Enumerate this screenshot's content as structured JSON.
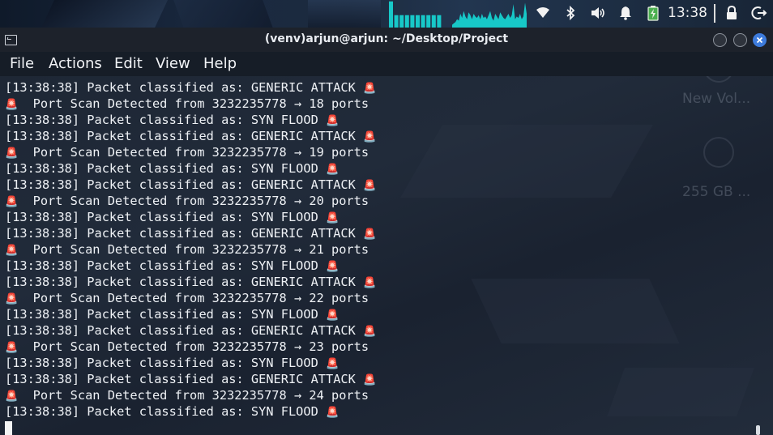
{
  "panel": {
    "clock": "13:38",
    "icons": [
      "wifi-icon",
      "bluetooth-icon",
      "volume-icon",
      "bell-icon",
      "battery-charging-icon",
      "lock-icon",
      "logout-icon"
    ],
    "cpu_bars": [
      0.95,
      0.45,
      0.45,
      0.45,
      0.45,
      0.45,
      0.45,
      0.45,
      0.45,
      0.45
    ],
    "net_levels": [
      0.1,
      0.15,
      0.2,
      0.3,
      0.25,
      0.5,
      0.35,
      0.6,
      0.4,
      0.3,
      0.55,
      0.45,
      0.3,
      0.5,
      0.4,
      0.35,
      0.45,
      0.3,
      0.5,
      0.35,
      0.4,
      0.3,
      0.45,
      0.6,
      0.35,
      0.25,
      0.5,
      0.4,
      0.3,
      0.55,
      0.45,
      0.35,
      0.3,
      0.4,
      0.5,
      0.35,
      0.45,
      0.85,
      0.3,
      0.4,
      0.35,
      0.5,
      0.3,
      0.4,
      0.9,
      0.5
    ],
    "accent": "#17c8c8"
  },
  "window": {
    "title": "(venv)arjun@arjun: ~/Desktop/Project",
    "menu": [
      "File",
      "Actions",
      "Edit",
      "View",
      "Help"
    ]
  },
  "desktop": {
    "labels": [
      "New Vol...",
      "255 GB ..."
    ]
  },
  "terminal": {
    "siren_glyph": "🚨",
    "lines": [
      {
        "text": "[13:38:38] Packet classified as: GENERIC ATTACK",
        "prefix": false,
        "suffix": true
      },
      {
        "text": "  Port Scan Detected from 3232235778 → 18 ports",
        "prefix": true,
        "suffix": false
      },
      {
        "text": "[13:38:38] Packet classified as: SYN FLOOD",
        "prefix": false,
        "suffix": true
      },
      {
        "text": "[13:38:38] Packet classified as: GENERIC ATTACK",
        "prefix": false,
        "suffix": true
      },
      {
        "text": "  Port Scan Detected from 3232235778 → 19 ports",
        "prefix": true,
        "suffix": false
      },
      {
        "text": "[13:38:38] Packet classified as: SYN FLOOD",
        "prefix": false,
        "suffix": true
      },
      {
        "text": "[13:38:38] Packet classified as: GENERIC ATTACK",
        "prefix": false,
        "suffix": true
      },
      {
        "text": "  Port Scan Detected from 3232235778 → 20 ports",
        "prefix": true,
        "suffix": false
      },
      {
        "text": "[13:38:38] Packet classified as: SYN FLOOD",
        "prefix": false,
        "suffix": true
      },
      {
        "text": "[13:38:38] Packet classified as: GENERIC ATTACK",
        "prefix": false,
        "suffix": true
      },
      {
        "text": "  Port Scan Detected from 3232235778 → 21 ports",
        "prefix": true,
        "suffix": false
      },
      {
        "text": "[13:38:38] Packet classified as: SYN FLOOD",
        "prefix": false,
        "suffix": true
      },
      {
        "text": "[13:38:38] Packet classified as: GENERIC ATTACK",
        "prefix": false,
        "suffix": true
      },
      {
        "text": "  Port Scan Detected from 3232235778 → 22 ports",
        "prefix": true,
        "suffix": false
      },
      {
        "text": "[13:38:38] Packet classified as: SYN FLOOD",
        "prefix": false,
        "suffix": true
      },
      {
        "text": "[13:38:38] Packet classified as: GENERIC ATTACK",
        "prefix": false,
        "suffix": true
      },
      {
        "text": "  Port Scan Detected from 3232235778 → 23 ports",
        "prefix": true,
        "suffix": false
      },
      {
        "text": "[13:38:38] Packet classified as: SYN FLOOD",
        "prefix": false,
        "suffix": true
      },
      {
        "text": "[13:38:38] Packet classified as: GENERIC ATTACK",
        "prefix": false,
        "suffix": true
      },
      {
        "text": "  Port Scan Detected from 3232235778 → 24 ports",
        "prefix": true,
        "suffix": false
      },
      {
        "text": "[13:38:38] Packet classified as: SYN FLOOD",
        "prefix": false,
        "suffix": true
      }
    ]
  }
}
